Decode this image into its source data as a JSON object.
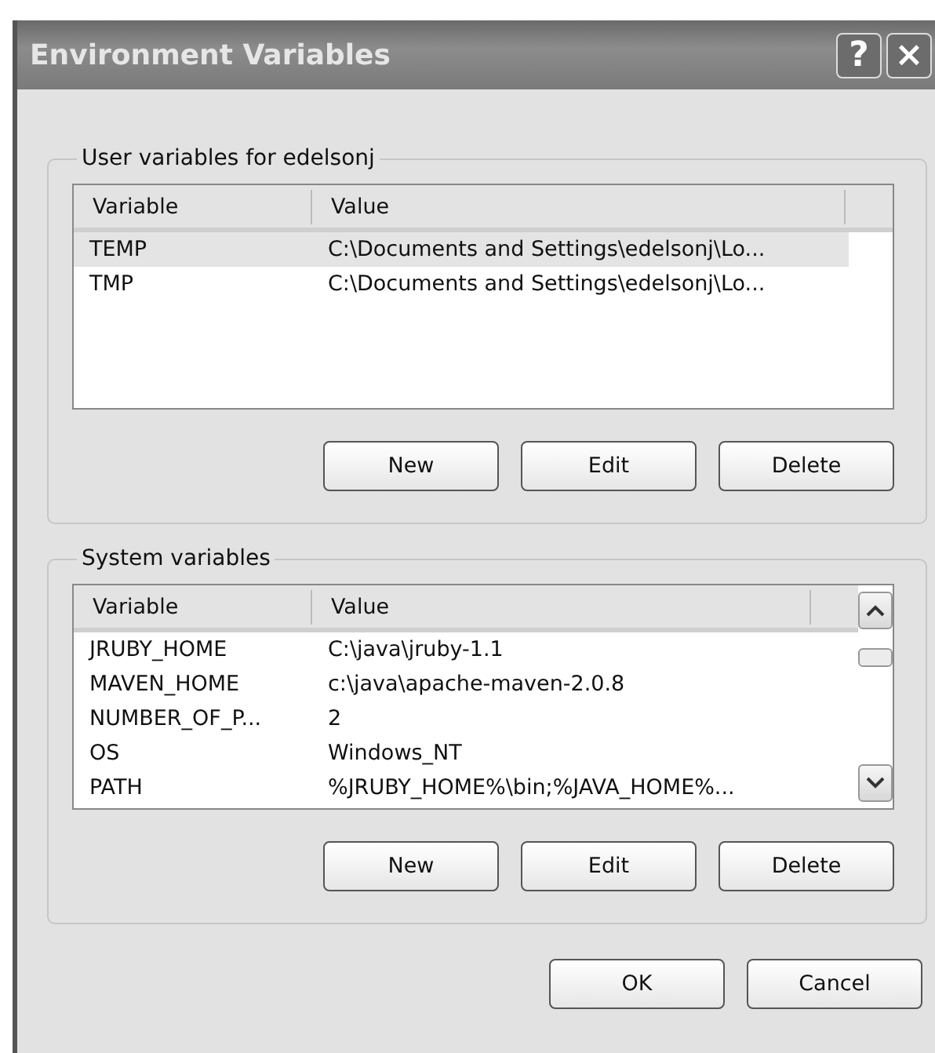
{
  "window": {
    "title": "Environment Variables",
    "title_buttons": [
      "?",
      "×"
    ]
  },
  "user_group": {
    "legend": "User variables for edelsonj",
    "columns": [
      "Variable",
      "Value"
    ],
    "rows": [
      {
        "variable": "TEMP",
        "value": "C:\\Documents and Settings\\edelsonj\\Lo...",
        "selected": true
      },
      {
        "variable": "TMP",
        "value": "C:\\Documents and Settings\\edelsonj\\Lo...",
        "selected": false
      }
    ],
    "buttons": [
      "New",
      "Edit",
      "Delete"
    ]
  },
  "system_group": {
    "legend": "System variables",
    "columns": [
      "Variable",
      "Value"
    ],
    "rows": [
      {
        "variable": "JRUBY_HOME",
        "value": "C:\\java\\jruby-1.1",
        "selected": false
      },
      {
        "variable": "MAVEN_HOME",
        "value": "c:\\java\\apache-maven-2.0.8",
        "selected": false
      },
      {
        "variable": "NUMBER_OF_P...",
        "value": "2",
        "selected": false
      },
      {
        "variable": "OS",
        "value": "Windows_NT",
        "selected": false
      },
      {
        "variable": "PATH",
        "value": "%JRUBY_HOME%\\bin;%JAVA_HOME%...",
        "selected": false
      }
    ],
    "buttons": [
      "New",
      "Edit",
      "Delete"
    ]
  },
  "buttons": [
    "OK",
    "Cancel"
  ]
}
